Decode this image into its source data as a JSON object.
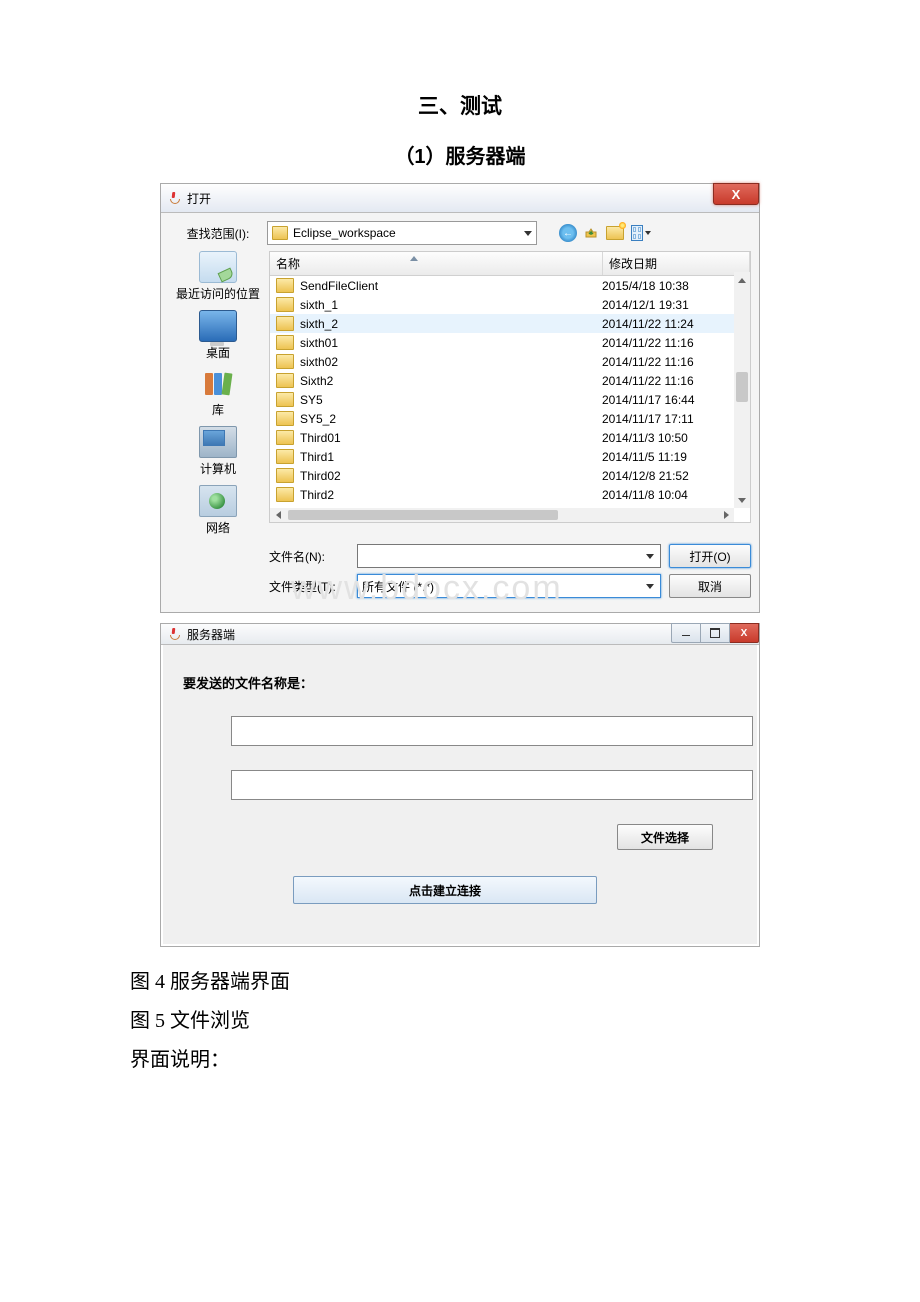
{
  "headings": {
    "main": "三、测试",
    "sub": "（1）服务器端"
  },
  "openDialog": {
    "title": "打开",
    "lookInLabel": "查找范围(I):",
    "folder": "Eclipse_workspace",
    "header": {
      "name": "名称",
      "date": "修改日期"
    },
    "items": [
      {
        "name": "SendFileClient",
        "date": "2015/4/18 10:38"
      },
      {
        "name": "sixth_1",
        "date": "2014/12/1 19:31"
      },
      {
        "name": "sixth_2",
        "date": "2014/11/22 11:24"
      },
      {
        "name": "sixth01",
        "date": "2014/11/22 11:16"
      },
      {
        "name": "sixth02",
        "date": "2014/11/22 11:16"
      },
      {
        "name": "Sixth2",
        "date": "2014/11/22 11:16"
      },
      {
        "name": "SY5",
        "date": "2014/11/17 16:44"
      },
      {
        "name": "SY5_2",
        "date": "2014/11/17 17:11"
      },
      {
        "name": "Third01",
        "date": "2014/11/3 10:50"
      },
      {
        "name": "Third1",
        "date": "2014/11/5 11:19"
      },
      {
        "name": "Third02",
        "date": "2014/12/8 21:52"
      },
      {
        "name": "Third2",
        "date": "2014/11/8 10:04"
      }
    ],
    "places": {
      "recent": "最近访问的位置",
      "desktop": "桌面",
      "libraries": "库",
      "computer": "计算机",
      "network": "网络"
    },
    "fileNameLabel": "文件名(N):",
    "fileTypeLabel": "文件类型(T):",
    "fileTypeValue": "所有文件 (*.*)",
    "openBtn": "打开(O)",
    "cancelBtn": "取消"
  },
  "serverWindow": {
    "title": "服务器端",
    "sendLabel": "要发送的文件名称是：",
    "fileSelectBtn": "文件选择",
    "connectBtn": "点击建立连接"
  },
  "captions": {
    "fig4": "图 4 服务器端界面",
    "fig5": "图 5 文件浏览",
    "desc": "界面说明："
  },
  "watermark": "www.bdocx.com"
}
